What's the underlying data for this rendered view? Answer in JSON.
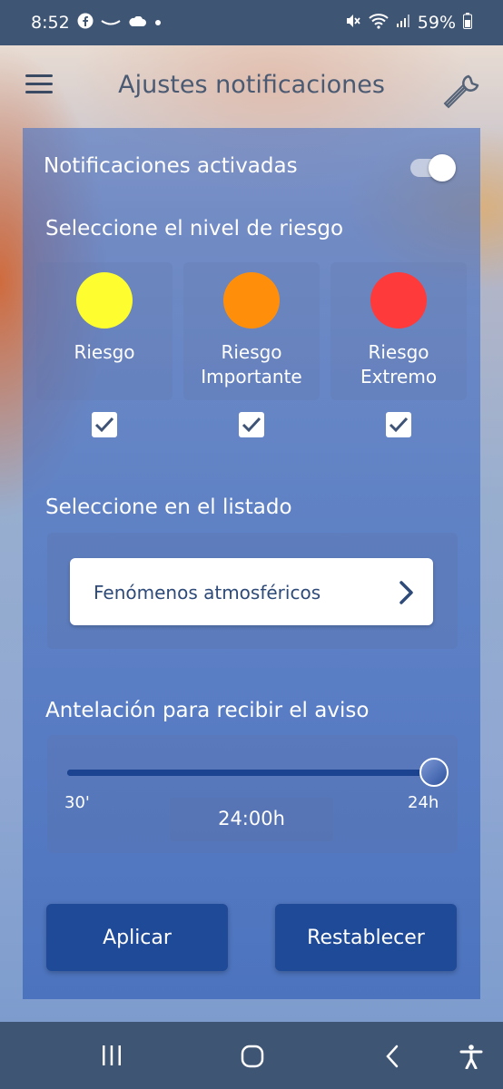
{
  "status_bar": {
    "time": "8:52",
    "left_icons": [
      "facebook-icon",
      "missed-call-icon",
      "cloud-icon",
      "dot-icon"
    ],
    "battery": "59%",
    "right_icons": [
      "mute-icon",
      "wifi-icon",
      "signal-icon",
      "battery-icon"
    ]
  },
  "header": {
    "title": "Ajustes notificaciones"
  },
  "notifications": {
    "label": "Notificaciones activadas",
    "enabled": true
  },
  "risk_section": {
    "label": "Seleccione el nivel de riesgo",
    "levels": [
      {
        "label": "Riesgo",
        "color": "#fdfd2f",
        "checked": true
      },
      {
        "label": "Riesgo Importante",
        "color": "#ff8f0a",
        "checked": true
      },
      {
        "label": "Riesgo Extremo",
        "color": "#ff3a3a",
        "checked": true
      }
    ]
  },
  "list_section": {
    "label": "Seleccione en el listado",
    "button_label": "Fenómenos atmosféricos"
  },
  "advance_section": {
    "label": "Antelación para recibir el aviso",
    "min_label": "30'",
    "max_label": "24h",
    "value_label": "24:00h",
    "value_fraction": 1.0
  },
  "actions": {
    "apply_label": "Aplicar",
    "reset_label": "Restablecer"
  },
  "nav": {
    "items": [
      "recent-apps-icon",
      "home-icon",
      "back-icon",
      "accessibility-icon"
    ]
  },
  "colors": {
    "accent": "#1f4a97",
    "status_bar": "#3f5574"
  }
}
